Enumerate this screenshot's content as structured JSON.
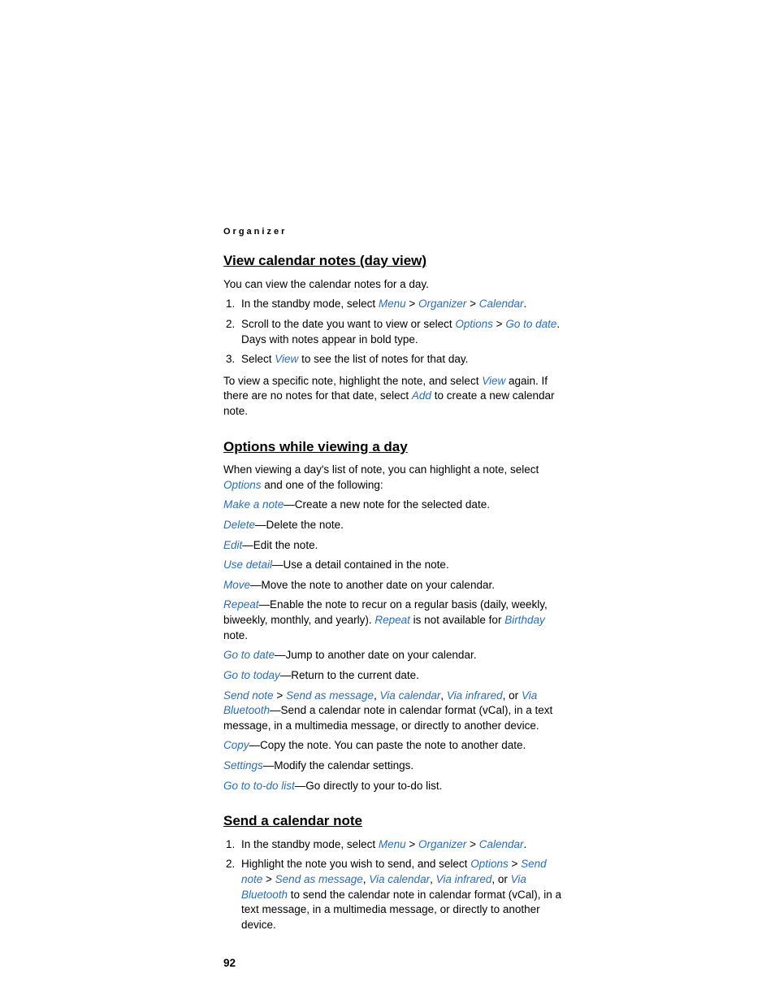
{
  "header": {
    "label": "Organizer"
  },
  "section1": {
    "title": "View calendar notes (day view)",
    "intro": "You can view the calendar notes for a day.",
    "steps": [
      {
        "pre": "In the standby mode, select ",
        "path": [
          "Menu",
          "Organizer",
          "Calendar"
        ],
        "post": "."
      },
      {
        "pre": "Scroll to the date you want to view or select ",
        "path": [
          "Options",
          "Go to date"
        ],
        "post": ". Days with notes appear in bold type."
      },
      {
        "pre": "Select ",
        "kw": "View",
        "post": " to see the list of notes for that day."
      }
    ],
    "trail": {
      "pre": "To view a specific note, highlight the note, and select ",
      "kw1": "View",
      "mid": " again. If there are no notes for that date, select ",
      "kw2": "Add",
      "post": " to create a new calendar note."
    }
  },
  "section2": {
    "title": "Options while viewing a day",
    "intro": {
      "pre": "When viewing a day's list of note, you can highlight a note, select ",
      "kw": "Options",
      "post": " and one of the following:"
    },
    "items": [
      {
        "kw": "Make a note",
        "desc": "—Create a new note for the selected date."
      },
      {
        "kw": "Delete",
        "desc": "—Delete the note."
      },
      {
        "kw": "Edit",
        "desc": "—Edit the note."
      },
      {
        "kw": "Use detail",
        "desc": "—Use a detail contained in the note."
      },
      {
        "kw": "Move",
        "desc": "—Move the note to another date on your calendar."
      }
    ],
    "repeat": {
      "kw": "Repeat",
      "pre": "—Enable the note to recur on a regular basis (daily, weekly, biweekly, monthly, and yearly). ",
      "kw2": "Repeat",
      "mid": " is not available for ",
      "kw3": "Birthday",
      "post": " note."
    },
    "items2": [
      {
        "kw": "Go to date",
        "desc": "—Jump to another date on your calendar."
      },
      {
        "kw": "Go to today",
        "desc": "—Return to the current date."
      }
    ],
    "sendnote": {
      "kw1": "Send note",
      "kw2": "Send as message",
      "kw3": "Via calendar",
      "kw4": "Via infrared",
      "or": ", or ",
      "kw5": "Via Bluetooth",
      "post": "—Send a calendar note in calendar format (vCal), in a text message, in a multimedia message, or directly to another device."
    },
    "items3": [
      {
        "kw": "Copy",
        "desc": "—Copy the note. You can paste the note to another date."
      },
      {
        "kw": "Settings",
        "desc": "—Modify the calendar settings."
      },
      {
        "kw": "Go to to-do list",
        "desc": "—Go directly to your to-do list."
      }
    ]
  },
  "section3": {
    "title": "Send a calendar note",
    "steps": {
      "s1": {
        "pre": "In the standby mode, select ",
        "path": [
          "Menu",
          "Organizer",
          "Calendar"
        ],
        "post": "."
      },
      "s2": {
        "pre": "Highlight the note you wish to send, and select ",
        "k1": "Options",
        "k2": "Send note",
        "k3": "Send as message",
        "k4": "Via calendar",
        "k5": "Via infrared",
        "or": ", or ",
        "k6": "Via Bluetooth",
        "post": " to send the calendar note in calendar format (vCal), in a text message, in a multimedia message, or directly to another device."
      }
    }
  },
  "pageNumber": "92",
  "sep": " > ",
  "comma": ", "
}
